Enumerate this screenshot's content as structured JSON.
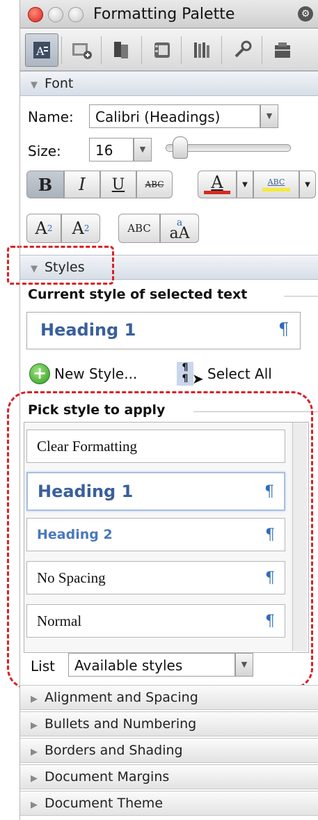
{
  "window": {
    "title": "Formatting Palette"
  },
  "toolbar": {
    "icons": [
      "formatting-palette-icon",
      "object-palette-icon",
      "citations-icon",
      "scrapbook-icon",
      "reference-tools-icon",
      "compatibility-report-icon",
      "project-palette-icon"
    ]
  },
  "font": {
    "section_label": "Font",
    "name_label": "Name:",
    "name_value": "Calibri (Headings)",
    "size_label": "Size:",
    "size_value": "16",
    "bold": "B",
    "italic": "I",
    "underline": "U",
    "strikethrough": "ABC",
    "font_color": "A",
    "highlight": "ABC",
    "superscript_base": "A",
    "superscript_exp": "2",
    "subscript_base": "A",
    "subscript_sub": "2",
    "small_caps": "ABC",
    "change_case_top": "a",
    "change_case_bottom": "aA",
    "colors": {
      "font_color_bar": "#d62a1e",
      "highlight_bar": "#f4ea3a"
    }
  },
  "styles": {
    "section_label": "Styles",
    "current_label": "Current style of selected text",
    "current_value": "Heading 1",
    "pilcrow": "¶",
    "new_style": "New Style...",
    "select_all": "Select All",
    "pick_label": "Pick style to apply",
    "items": [
      "Clear Formatting",
      "Heading 1",
      "Heading 2",
      "No Spacing",
      "Normal"
    ],
    "list_label": "List",
    "list_value": "Available styles"
  },
  "collapsed_sections": [
    "Alignment and Spacing",
    "Bullets and Numbering",
    "Borders and Shading",
    "Document Margins",
    "Document Theme"
  ],
  "colors": {
    "accent": "#2f6db8",
    "heading": "#3a5f9c",
    "callout": "#d91f26"
  }
}
